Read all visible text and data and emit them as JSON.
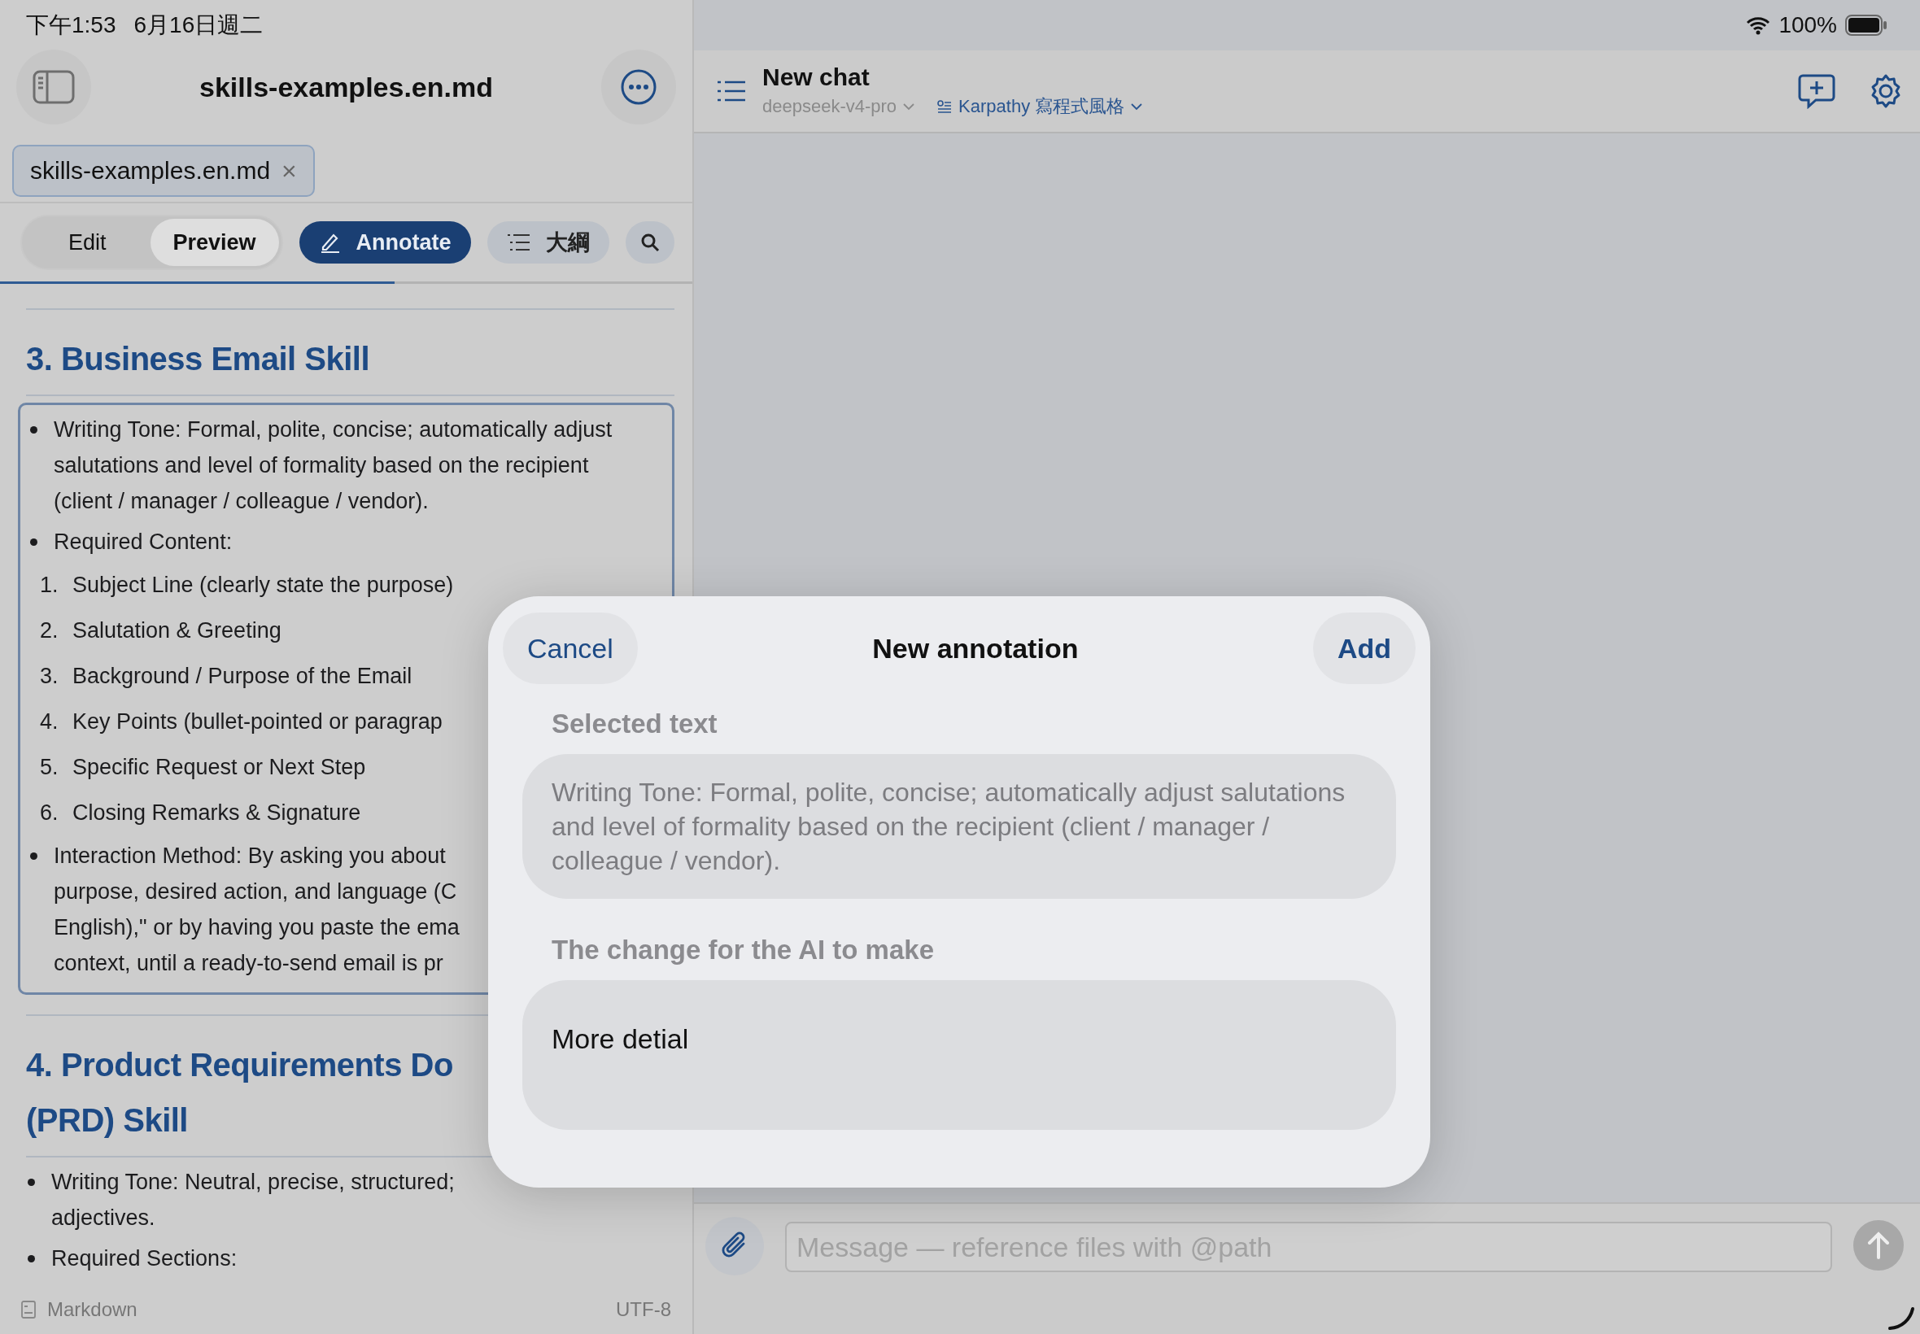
{
  "status_bar": {
    "time": "下午1:53",
    "date": "6月16日週二",
    "battery": "100%"
  },
  "document": {
    "title": "skills-examples.en.md",
    "tab": {
      "label": "skills-examples.en.md",
      "close": "×"
    },
    "modes": [
      {
        "label": "Edit",
        "selected": false
      },
      {
        "label": "Preview",
        "selected": true
      }
    ],
    "annotate": {
      "label": "Annotate",
      "on": true
    },
    "outline": {
      "label": "大綱"
    },
    "blocks": [
      {
        "kind": "heading",
        "lines": [
          "3. Business Email Skill"
        ]
      },
      {
        "kind": "highlight",
        "items": [
          {
            "kind": "bullet",
            "lines": [
              "Writing Tone: Formal, polite, concise; automatically adjust",
              "salutations and level of formality based on the recipient",
              "(client / manager / colleague / vendor)."
            ]
          },
          {
            "kind": "bullet",
            "lines": [
              "Required Content:"
            ]
          },
          {
            "kind": "numbered",
            "number": "1.",
            "text": "Subject Line (clearly state the purpose)"
          },
          {
            "kind": "numbered",
            "number": "2.",
            "text": "Salutation & Greeting"
          },
          {
            "kind": "numbered",
            "number": "3.",
            "text": "Background / Purpose of the Email"
          },
          {
            "kind": "numbered",
            "number": "4.",
            "text": "Key Points (bullet-pointed or paragrap"
          },
          {
            "kind": "numbered",
            "number": "5.",
            "text": "Specific Request or Next Step"
          },
          {
            "kind": "numbered",
            "number": "6.",
            "text": "Closing Remarks & Signature"
          },
          {
            "kind": "bullet",
            "lines": [
              "Interaction Method: By asking you about",
              "purpose, desired action, and language (C",
              "English),\" or by having you paste the ema",
              "context, until a ready-to-send email is pr"
            ]
          }
        ]
      },
      {
        "kind": "heading",
        "lines": [
          "4. Product Requirements Do",
          "(PRD) Skill"
        ]
      },
      {
        "kind": "bullet",
        "lines": [
          "Writing Tone: Neutral, precise, structured;",
          "adjectives."
        ]
      },
      {
        "kind": "bullet",
        "lines": [
          "Required Sections:"
        ]
      }
    ],
    "footer": {
      "format": "Markdown",
      "encoding": "UTF-8"
    }
  },
  "chat": {
    "title": "New chat",
    "model": "deepseek-v4-pro",
    "persona": "Karpathy 寫程式風格",
    "input": {
      "placeholder": "Message — reference files with @path"
    }
  },
  "dialog": {
    "cancel": "Cancel",
    "title": "New annotation",
    "add": "Add",
    "selected_label": "Selected text",
    "selected_text": "Writing Tone: Formal, polite, concise; automatically adjust salutations and level of formality based on the recipient (client / manager / colleague / vendor).",
    "change_label": "The change for the AI to make",
    "change_value": "More detial"
  }
}
